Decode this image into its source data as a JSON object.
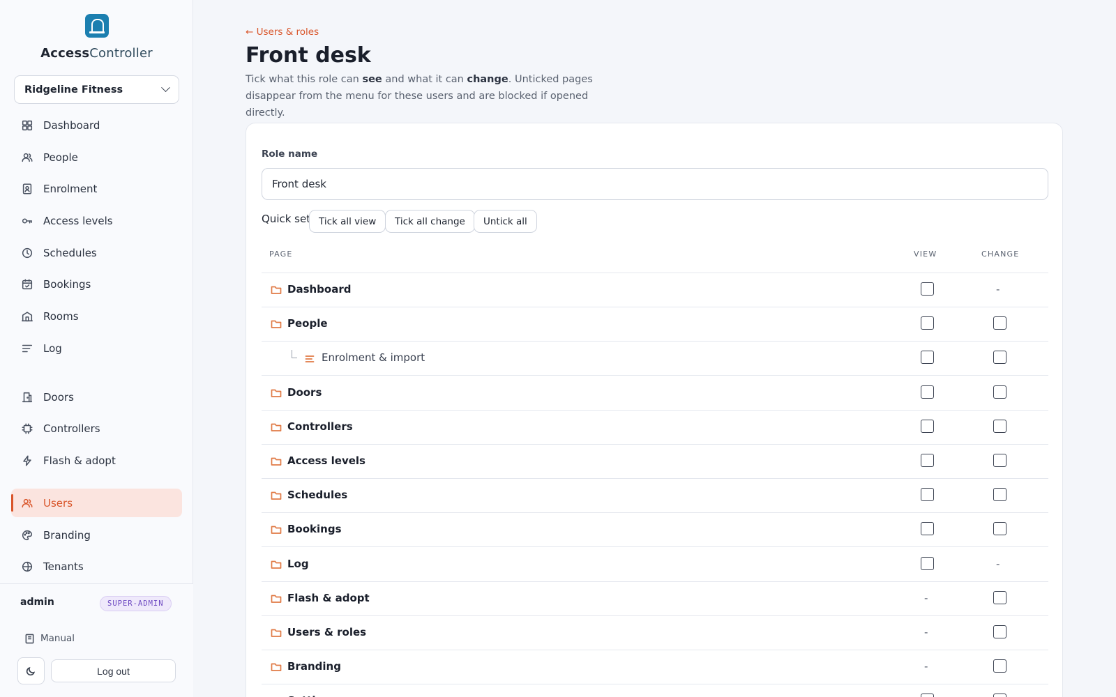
{
  "brand": {
    "name_strong": "Access",
    "name_light": "Controller",
    "logo_icon": "door-lock-icon",
    "logo_color": "#1c7fb0"
  },
  "tenant": {
    "selected": "Ridgeline Fitness"
  },
  "sidebar": {
    "items": [
      {
        "label": "Dashboard",
        "icon": "grid-icon"
      },
      {
        "label": "People",
        "icon": "users-icon"
      },
      {
        "label": "Enrolment",
        "icon": "id-badge-icon"
      },
      {
        "label": "Access levels",
        "icon": "key-icon"
      },
      {
        "label": "Schedules",
        "icon": "clock-icon"
      },
      {
        "label": "Bookings",
        "icon": "calendar-check-icon"
      },
      {
        "label": "Rooms",
        "icon": "building-icon"
      },
      {
        "label": "Log",
        "icon": "list-icon"
      },
      {
        "label": "Doors",
        "icon": "door-icon"
      },
      {
        "label": "Controllers",
        "icon": "chip-icon"
      },
      {
        "label": "Flash & adopt",
        "icon": "bolt-icon"
      },
      {
        "label": "Users",
        "icon": "users-icon",
        "active": true
      },
      {
        "label": "Branding",
        "icon": "palette-icon"
      },
      {
        "label": "Tenants",
        "icon": "tenants-icon"
      }
    ]
  },
  "account": {
    "username": "admin",
    "role_badge": "SUPER-ADMIN",
    "manual_label": "Manual",
    "logout_label": "Log out"
  },
  "page": {
    "back_link": "← Users & roles",
    "title": "Front desk",
    "desc_1": "Tick what this role can ",
    "desc_see": "see",
    "desc_2": " and what it can ",
    "desc_change": "change",
    "desc_3": ". Unticked pages disappear from the menu for these users and are blocked if opened directly."
  },
  "form": {
    "role_name_label": "Role name",
    "role_name_value": "Front desk",
    "quick_set_label": "Quick set",
    "quick_buttons": [
      "Tick all view",
      "Tick all change",
      "Untick all"
    ]
  },
  "table": {
    "headers": {
      "page": "PAGE",
      "view": "VIEW",
      "change": "CHANGE"
    },
    "rows": [
      {
        "name": "Dashboard",
        "view": "checkbox",
        "change": "-"
      },
      {
        "name": "People",
        "view": "checkbox",
        "change": "checkbox"
      },
      {
        "name": "Enrolment & import",
        "child": true,
        "view": "checkbox",
        "change": "checkbox"
      },
      {
        "name": "Doors",
        "view": "checkbox",
        "change": "checkbox"
      },
      {
        "name": "Controllers",
        "view": "checkbox",
        "change": "checkbox"
      },
      {
        "name": "Access levels",
        "view": "checkbox",
        "change": "checkbox"
      },
      {
        "name": "Schedules",
        "view": "checkbox",
        "change": "checkbox"
      },
      {
        "name": "Bookings",
        "view": "checkbox",
        "change": "checkbox"
      },
      {
        "name": "Log",
        "view": "checkbox",
        "change": "-"
      },
      {
        "name": "Flash & adopt",
        "view": "-",
        "change": "checkbox"
      },
      {
        "name": "Users & roles",
        "view": "-",
        "change": "checkbox"
      },
      {
        "name": "Branding",
        "view": "-",
        "change": "checkbox"
      },
      {
        "name": "Settings",
        "view": "checkbox",
        "change": "checkbox"
      }
    ]
  },
  "colors": {
    "accent": "#d9552a",
    "accent_bg": "#fbe4df",
    "folder_icon": "#e07a45",
    "badge_purple": "#6b46c1"
  }
}
